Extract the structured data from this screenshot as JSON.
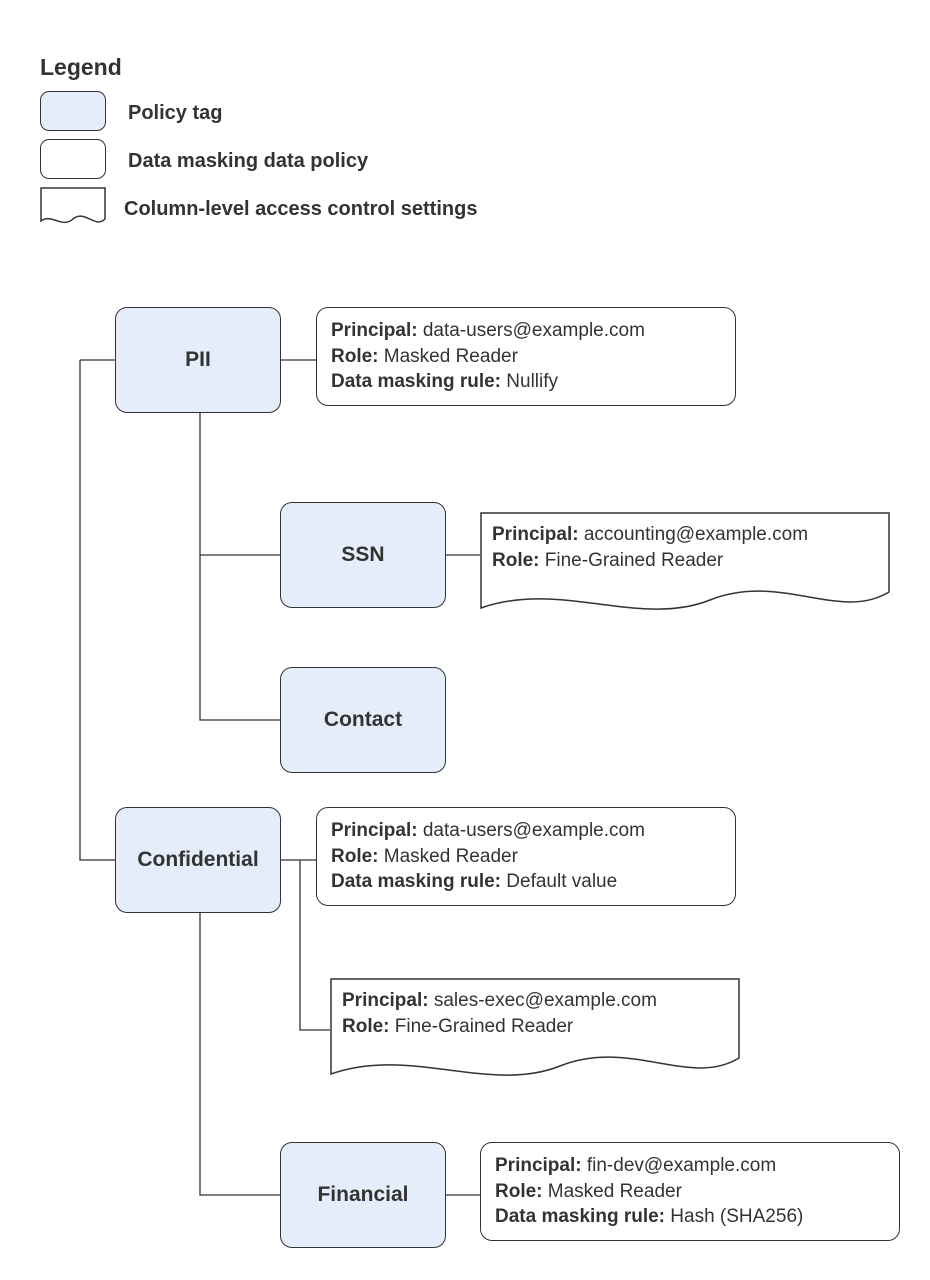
{
  "legend": {
    "title": "Legend",
    "items": [
      {
        "label": "Policy tag"
      },
      {
        "label": "Data masking data policy"
      },
      {
        "label": "Column-level access control settings"
      }
    ]
  },
  "labels": {
    "principal": "Principal:",
    "role": "Role:",
    "rule": "Data masking rule:"
  },
  "tags": {
    "pii": "PII",
    "ssn": "SSN",
    "contact": "Contact",
    "confidential": "Confidential",
    "financial": "Financial"
  },
  "pii_policy": {
    "principal": "data-users@example.com",
    "role": "Masked Reader",
    "rule": "Nullify"
  },
  "ssn_acl": {
    "principal": "accounting@example.com",
    "role": "Fine-Grained Reader"
  },
  "conf_policy": {
    "principal": "data-users@example.com",
    "role": "Masked Reader",
    "rule": "Default value"
  },
  "conf_acl": {
    "principal": "sales-exec@example.com",
    "role": "Fine-Grained Reader"
  },
  "fin_policy": {
    "principal": "fin-dev@example.com",
    "role": "Masked Reader",
    "rule": "Hash (SHA256)"
  }
}
